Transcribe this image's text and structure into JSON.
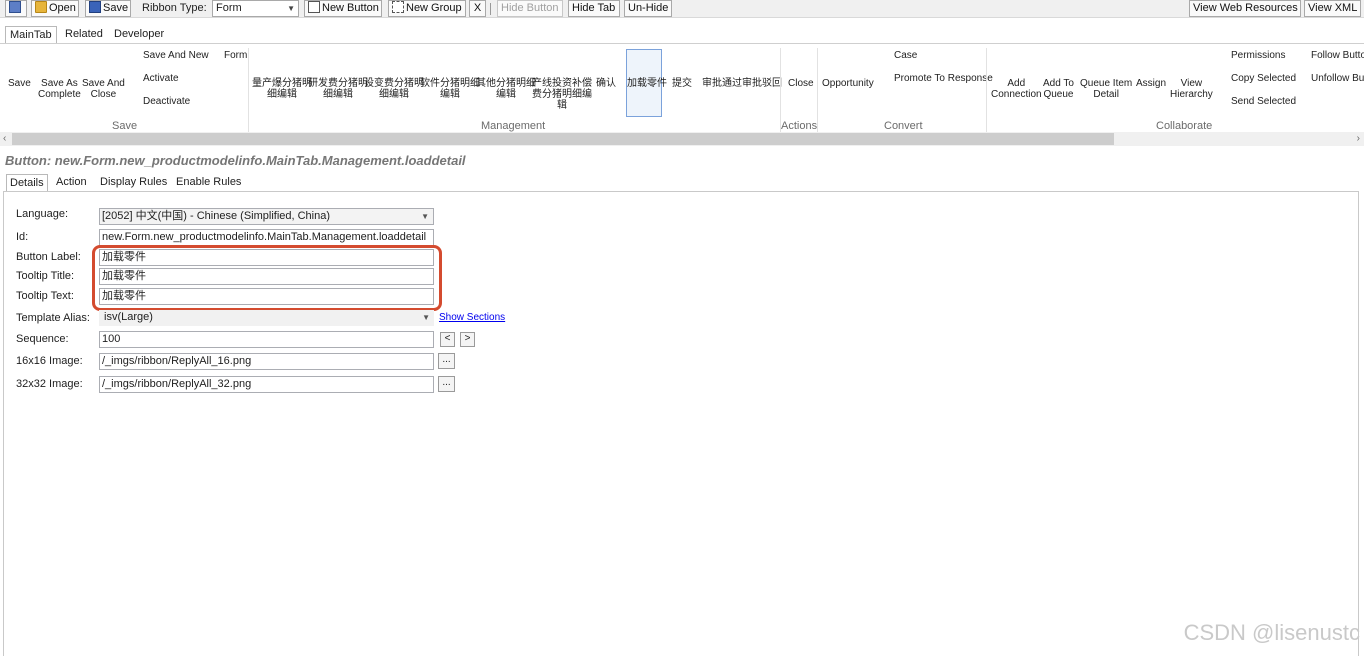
{
  "toolbar": {
    "open_label": "Open",
    "save_label": "Save",
    "ribbon_type_label": "Ribbon Type:",
    "ribbon_type_value": "Form",
    "new_button_label": "New Button",
    "new_group_label": "New Group",
    "delete_label": "X",
    "hide_button_label": "Hide Button",
    "hide_tab_label": "Hide Tab",
    "unhide_label": "Un-Hide",
    "view_web_resources_label": "View Web Resources",
    "view_xml_label": "View XML"
  },
  "ribbon_tabs": [
    "MainTab",
    "Related",
    "Developer"
  ],
  "ribbon": {
    "save_group": {
      "name": "Save",
      "save": "Save",
      "save_as_complete_1": "Save As",
      "save_as_complete_2": "Complete",
      "save_and_close_1": "Save And",
      "save_and_close_2": "Close",
      "save_and_new": "Save And New",
      "activate": "Activate",
      "deactivate": "Deactivate",
      "form": "Form"
    },
    "management_group": {
      "name": "Management",
      "b1_1": "量产爆分猪明",
      "b1_2": "细编辑",
      "b2_1": "研发费分猪明",
      "b2_2": "细编辑",
      "b3_1": "设变费分猪明",
      "b3_2": "细编辑",
      "b4_1": "软件分猪明细",
      "b4_2": "编辑",
      "b5_1": "其他分猪明细",
      "b5_2": "编辑",
      "b6_1": "产线投资补偿",
      "b6_2": "费分猪明细编",
      "b6_3": "辑",
      "b7": "确认",
      "b8": "加载零件",
      "b9": "提交",
      "b10": "审批通过",
      "b11": "审批驳回"
    },
    "actions_group": {
      "name": "Actions",
      "close": "Close"
    },
    "convert_group": {
      "name": "Convert",
      "opportunity": "Opportunity",
      "case": "Case",
      "promote": "Promote To Response"
    },
    "collaborate_group": {
      "name": "Collaborate",
      "add_connection_1": "Add",
      "add_connection_2": "Connection",
      "add_queue_1": "Add To",
      "add_queue_2": "Queue",
      "queue_item_1": "Queue Item",
      "queue_item_2": "Detail",
      "assign": "Assign",
      "view_hierarchy_1": "View",
      "view_hierarchy_2": "Hierarchy",
      "permissions": "Permissions",
      "copy_selected": "Copy Selected",
      "send_selected": "Send Selected",
      "follow": "Follow Butto",
      "unfollow": "Unfollow But"
    }
  },
  "heading": "Button: new.Form.new_productmodelinfo.MainTab.Management.loaddetail",
  "detail_tabs": [
    "Details",
    "Action",
    "Display Rules",
    "Enable Rules"
  ],
  "form": {
    "language_label": "Language:",
    "language_value": "[2052] 中文(中国) - Chinese (Simplified, China)",
    "id_label": "Id:",
    "id_value": "new.Form.new_productmodelinfo.MainTab.Management.loaddetail",
    "button_label_label": "Button Label:",
    "button_label_value": "加载零件",
    "tooltip_title_label": "Tooltip Title:",
    "tooltip_title_value": "加载零件",
    "tooltip_text_label": "Tooltip Text:",
    "tooltip_text_value": "加载零件",
    "template_alias_label": "Template Alias:",
    "template_alias_value": "isv(Large)",
    "show_sections_label": "Show Sections",
    "sequence_label": "Sequence:",
    "sequence_value": "100",
    "seq_prev": "<",
    "seq_next": ">",
    "img16_label": "16x16 Image:",
    "img16_value": "/_imgs/ribbon/ReplyAll_16.png",
    "img32_label": "32x32 Image:",
    "img32_value": "/_imgs/ribbon/ReplyAll_32.png",
    "browse_label": "..."
  },
  "watermark": "CSDN @lisenustc",
  "colors": {
    "highlight_border": "#d44b2f",
    "link": "#0000ee",
    "selected_button_border": "#7ba2db"
  }
}
